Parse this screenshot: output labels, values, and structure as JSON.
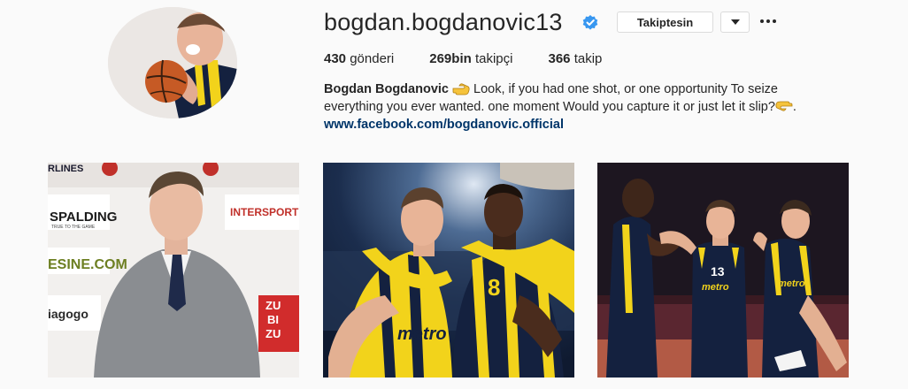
{
  "profile": {
    "username": "bogdan.bogdanovic13",
    "follow_label": "Takiptesin",
    "stats": {
      "posts_count": "430",
      "posts_label": "gönderi",
      "followers_count": "269bin",
      "followers_label": "takipçi",
      "following_count": "366",
      "following_label": "takip"
    },
    "bio": {
      "name": "Bogdan Bogdanovic",
      "text_line1": "Look, if you had one shot, or one opportunity To seize",
      "text_line2": "everything you ever wanted. one moment Would you capture it or just let it slip?",
      "text_end": ".",
      "link": "www.facebook.com/bogdanovic.official"
    }
  },
  "posts": [
    {
      "id": "post-1",
      "sponsor_texts": [
        "RLINES",
        "SPALDING",
        "TRUE TO THE GAME",
        "INTERSPORT",
        "ESINE.COM",
        "iagogo",
        "ZU",
        "BI",
        "ZU"
      ]
    },
    {
      "id": "post-2",
      "jersey_texts": [
        "metro",
        "8"
      ]
    },
    {
      "id": "post-3",
      "jersey_texts": [
        "13",
        "metro",
        "metro"
      ]
    }
  ],
  "colors": {
    "link": "#003569",
    "verified": "#3897f0",
    "text": "#262626",
    "border": "#dbdbdb",
    "background": "#fafafa",
    "jersey_yellow": "#f2d31b",
    "jersey_navy": "#14213f"
  },
  "icons": {
    "verified": "verified-badge-icon",
    "dropdown": "chevron-down-icon",
    "more": "more-options-icon",
    "hand": "pointing-hand-emoji"
  }
}
